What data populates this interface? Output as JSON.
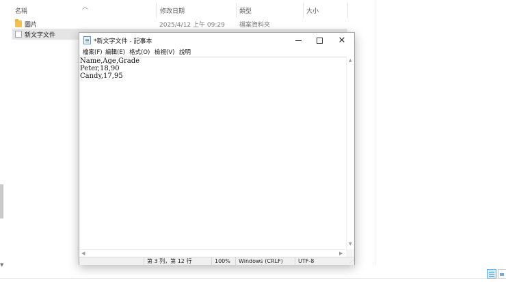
{
  "explorer": {
    "columns": {
      "name": "名稱",
      "modified": "修改日期",
      "type": "類型",
      "size": "大小"
    },
    "rows": [
      {
        "name": "圖片",
        "modified": "2025/4/12 上午 09:29",
        "type": "檔案資料夾",
        "size": "",
        "icon": "folder-icon"
      },
      {
        "name": "新文字文件",
        "modified": "",
        "type": "",
        "size": "",
        "icon": "text-file-icon"
      }
    ]
  },
  "notepad": {
    "title": "*新文字文件 - 記事本",
    "menu": [
      "檔案(F)",
      "編輯(E)",
      "格式(O)",
      "檢視(V)",
      "說明"
    ],
    "content": [
      "Name,Age,Grade",
      "Peter,18,90",
      "Candy,17,95"
    ],
    "status": {
      "position": "第 3 列，第 12 行",
      "zoom": "100%",
      "line_ending": "Windows (CRLF)",
      "encoding": "UTF-8"
    }
  }
}
